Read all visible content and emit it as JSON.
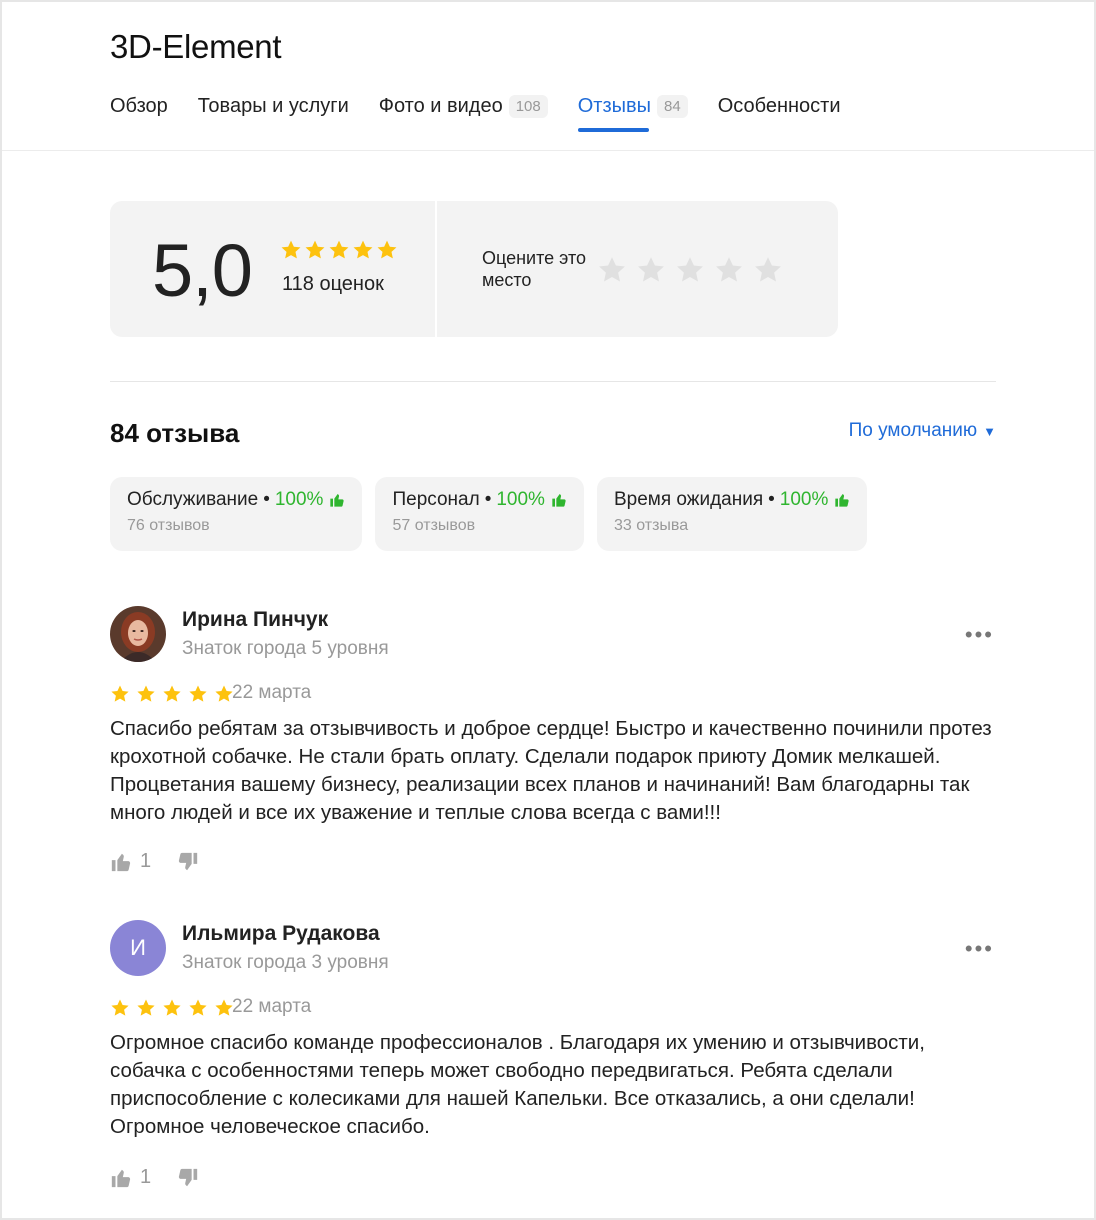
{
  "org": {
    "name": "3D-Element"
  },
  "tabs": [
    {
      "label": "Обзор",
      "count": null,
      "active": false
    },
    {
      "label": "Товары и услуги",
      "count": null,
      "active": false
    },
    {
      "label": "Фото и видео",
      "count": "108",
      "active": false
    },
    {
      "label": "Отзывы",
      "count": "84",
      "active": true
    },
    {
      "label": "Особенности",
      "count": null,
      "active": false
    }
  ],
  "rating": {
    "score": "5,0",
    "stars": 5,
    "count_label": "118 оценок",
    "rate_prompt": "Оцените это место",
    "rate_stars": 5
  },
  "reviews_section": {
    "heading": "84 отзыва",
    "sort_label": "По умолчанию",
    "aspects": [
      {
        "label": "Обслуживание",
        "percent": "100%",
        "count_label": "76 отзывов"
      },
      {
        "label": "Персонал",
        "percent": "100%",
        "count_label": "57 отзывов"
      },
      {
        "label": "Время ожидания",
        "percent": "100%",
        "count_label": "33 отзыва"
      }
    ]
  },
  "reviews": [
    {
      "author": "Ирина Пинчук",
      "level": "Знаток города 5 уровня",
      "avatar_type": "photo",
      "avatar_letter": "",
      "stars": 5,
      "date": "22 марта",
      "text": "Спасибо ребятам за отзывчивость и доброе сердце! Быстро и качественно починили протез крохотной собачке. Не стали брать оплату. Сделали подарок приюту Домик мелкашей. Процветания вашему бизнесу, реализации всех планов и начинаний! Вам благодарны так много людей и все их уважение и теплые слова всегда с вами!!!",
      "likes": "1"
    },
    {
      "author": "Ильмира Рудакова",
      "level": "Знаток города 3 уровня",
      "avatar_type": "letter",
      "avatar_letter": "И",
      "stars": 5,
      "date": "22 марта",
      "text": "Огромное спасибо команде профессионалов . Благодаря их умению и отзывчивости, собачка с особенностями теперь может свободно передвигаться. Ребята сделали приспособление с колесиками для нашей Капельки. Все отказались, а они сделали! Огромное человеческое спасибо.",
      "likes": "1"
    }
  ],
  "colors": {
    "accent": "#1f6bd8",
    "star": "#fdc20e",
    "star_empty": "#e0e0e0",
    "positive": "#2fb52f",
    "avatar_letter_bg": "#8a85d6"
  },
  "icons": {
    "more": "more-dots-icon",
    "like": "thumb-up-icon",
    "dislike": "thumb-down-icon",
    "star": "star-icon"
  }
}
